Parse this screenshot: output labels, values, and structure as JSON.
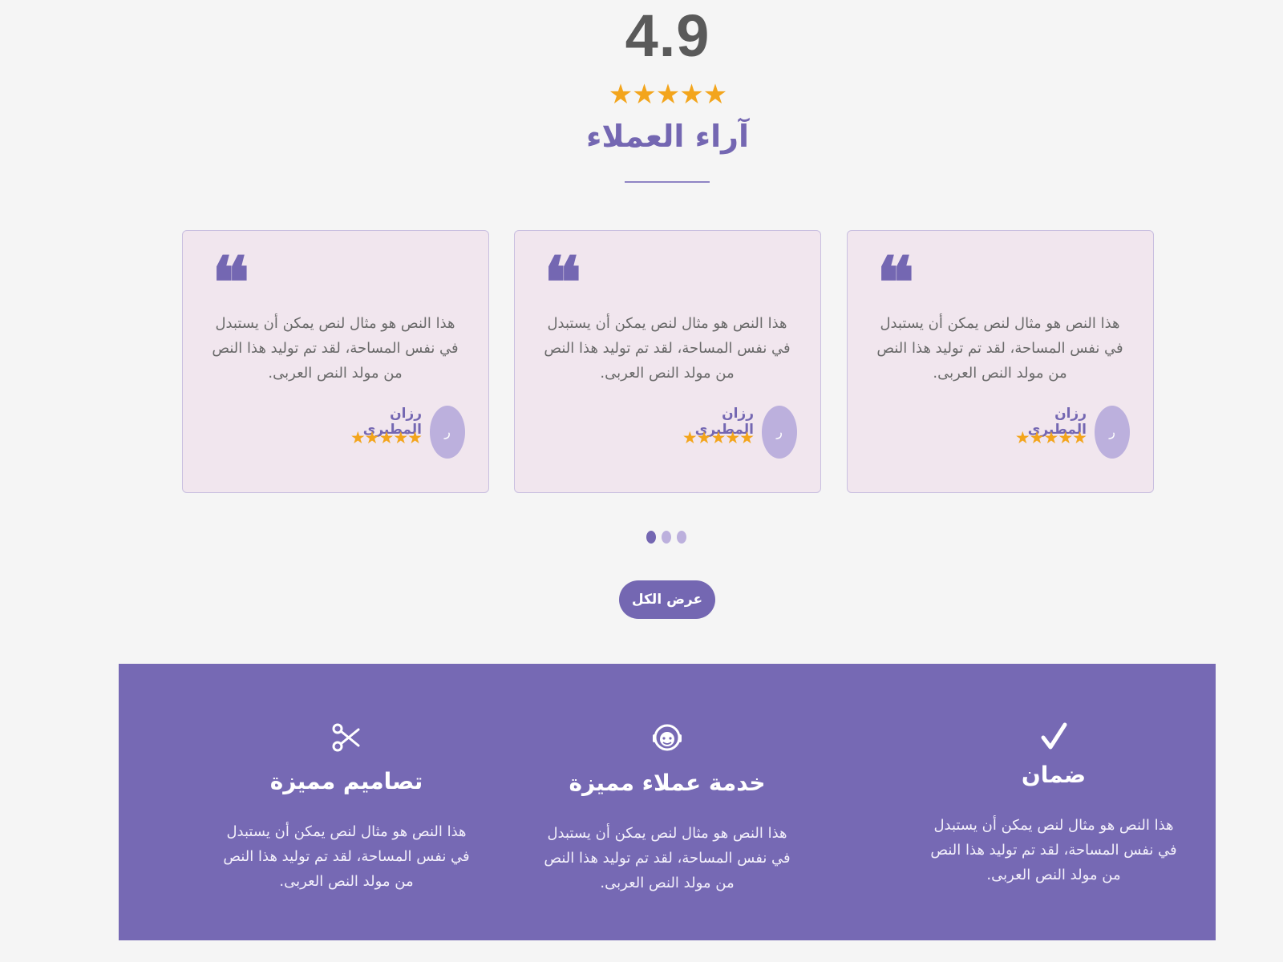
{
  "rating": {
    "score": "4.9",
    "stars": "★★★★★"
  },
  "testimonials": {
    "title": "آراء العملاء",
    "cards": [
      {
        "quote_mark": "❝",
        "text": "هذا النص هو مثال لنص يمكن أن يستبدل في نفس المساحة، لقد تم توليد هذا النص من مولد النص العربى.",
        "avatar_letter": "ر",
        "name": "رزان المطيري",
        "stars": "★★★★★"
      },
      {
        "quote_mark": "❝",
        "text": "هذا النص هو مثال لنص يمكن أن يستبدل في نفس المساحة، لقد تم توليد هذا النص من مولد النص العربى.",
        "avatar_letter": "ر",
        "name": "رزان المطيري",
        "stars": "★★★★★"
      },
      {
        "quote_mark": "❝",
        "text": "هذا النص هو مثال لنص يمكن أن يستبدل في نفس المساحة، لقد تم توليد هذا النص من مولد النص العربى.",
        "avatar_letter": "ر",
        "name": "رزان المطيري",
        "stars": "★★★★★"
      }
    ],
    "pagination": {
      "total": 3,
      "active": 1
    },
    "view_all_label": "عرض الكل"
  },
  "features": [
    {
      "icon": "check-icon",
      "title": "ضمان",
      "text": "هذا النص هو مثال لنص يمكن أن يستبدل في نفس المساحة، لقد تم توليد هذا النص من مولد النص العربى."
    },
    {
      "icon": "support-agent-icon",
      "title": "خدمة عملاء مميزة",
      "text": "هذا النص هو مثال لنص يمكن أن يستبدل في نفس المساحة، لقد تم توليد هذا النص من مولد النص العربى."
    },
    {
      "icon": "scissors-icon",
      "title": "تصاميم مميزة",
      "text": "هذا النص هو مثال لنص يمكن أن يستبدل في نفس المساحة، لقد تم توليد هذا النص من مولد النص العربى."
    }
  ],
  "colors": {
    "brand_purple": "#7467b2",
    "feature_band": "#7669b4",
    "card_background": "#f1e6ee",
    "star_gold": "#f3a51c",
    "page_background": "#f5f5f5"
  }
}
